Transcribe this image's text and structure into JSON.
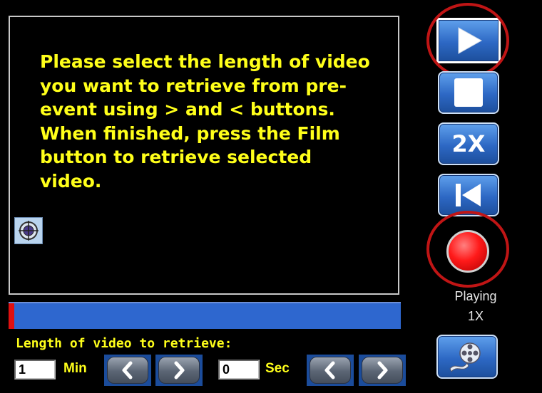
{
  "message": "Please select the length of video you want to retrieve from pre-event using > and < buttons. When finished, press the Film button to retrieve selected video.",
  "length": {
    "label": "Length of video to retrieve:",
    "minutes_value": "1",
    "minutes_unit": "Min",
    "seconds_value": "0",
    "seconds_unit": "Sec"
  },
  "side": {
    "speed_label": "2X",
    "status_text": "Playing",
    "status_speed": "1X"
  },
  "colors": {
    "message_text": "#ffff1a",
    "timeline": "#2e67cf",
    "highlight_ring": "#c01515",
    "button_blue": "#2d68c4"
  },
  "icons": [
    "target-icon",
    "chevron-left-icon",
    "chevron-right-icon",
    "play-icon",
    "stop-icon",
    "skip-to-start-icon",
    "record-icon",
    "film-reel-icon"
  ]
}
